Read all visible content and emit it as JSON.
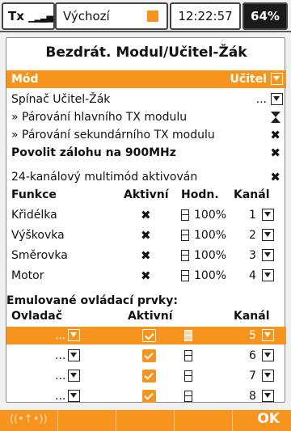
{
  "status_bar": {
    "tx_label": "Tx",
    "model_name": "Výchozí",
    "time": "12:22:57",
    "battery": "64%"
  },
  "title": "Bezdrát. Modul/Učitel-Žák",
  "mode": {
    "label": "Mód",
    "value": "Učitel"
  },
  "settings": [
    {
      "label": "Spínač Učitel-Žák",
      "value": "..."
    },
    {
      "label": "» Párování hlavního TX modulu"
    },
    {
      "label": "» Párování sekundárního TX modulu"
    },
    {
      "label": "Povolit zálohu na 900MHz"
    },
    {
      "label": "24-kanálový multimód aktivován"
    }
  ],
  "functions_header": {
    "funkce": "Funkce",
    "aktivni": "Aktivní",
    "hodn": "Hodn.",
    "kanal": "Kanál"
  },
  "functions": [
    {
      "name": "Křidélka",
      "value": "100%",
      "channel": "1"
    },
    {
      "name": "Výškovka",
      "value": "100%",
      "channel": "2"
    },
    {
      "name": "Směrovka",
      "value": "100%",
      "channel": "3"
    },
    {
      "name": "Motor",
      "value": "100%",
      "channel": "4"
    }
  ],
  "emulated_title": "Emulované ovládací prvky:",
  "emulated_header": {
    "ovladac": "Ovladač",
    "aktivni": "Aktivní",
    "kanal": "Kanál"
  },
  "emulated": [
    {
      "control": "...",
      "channel": "5"
    },
    {
      "control": "...",
      "channel": "6"
    },
    {
      "control": "...",
      "channel": "7"
    },
    {
      "control": "...",
      "channel": "8"
    }
  ],
  "bottom_bar": {
    "ok_label": "OK"
  },
  "colors": {
    "accent": "#f7941d",
    "panel": "#ffffff",
    "background": "#f0f0f0"
  }
}
